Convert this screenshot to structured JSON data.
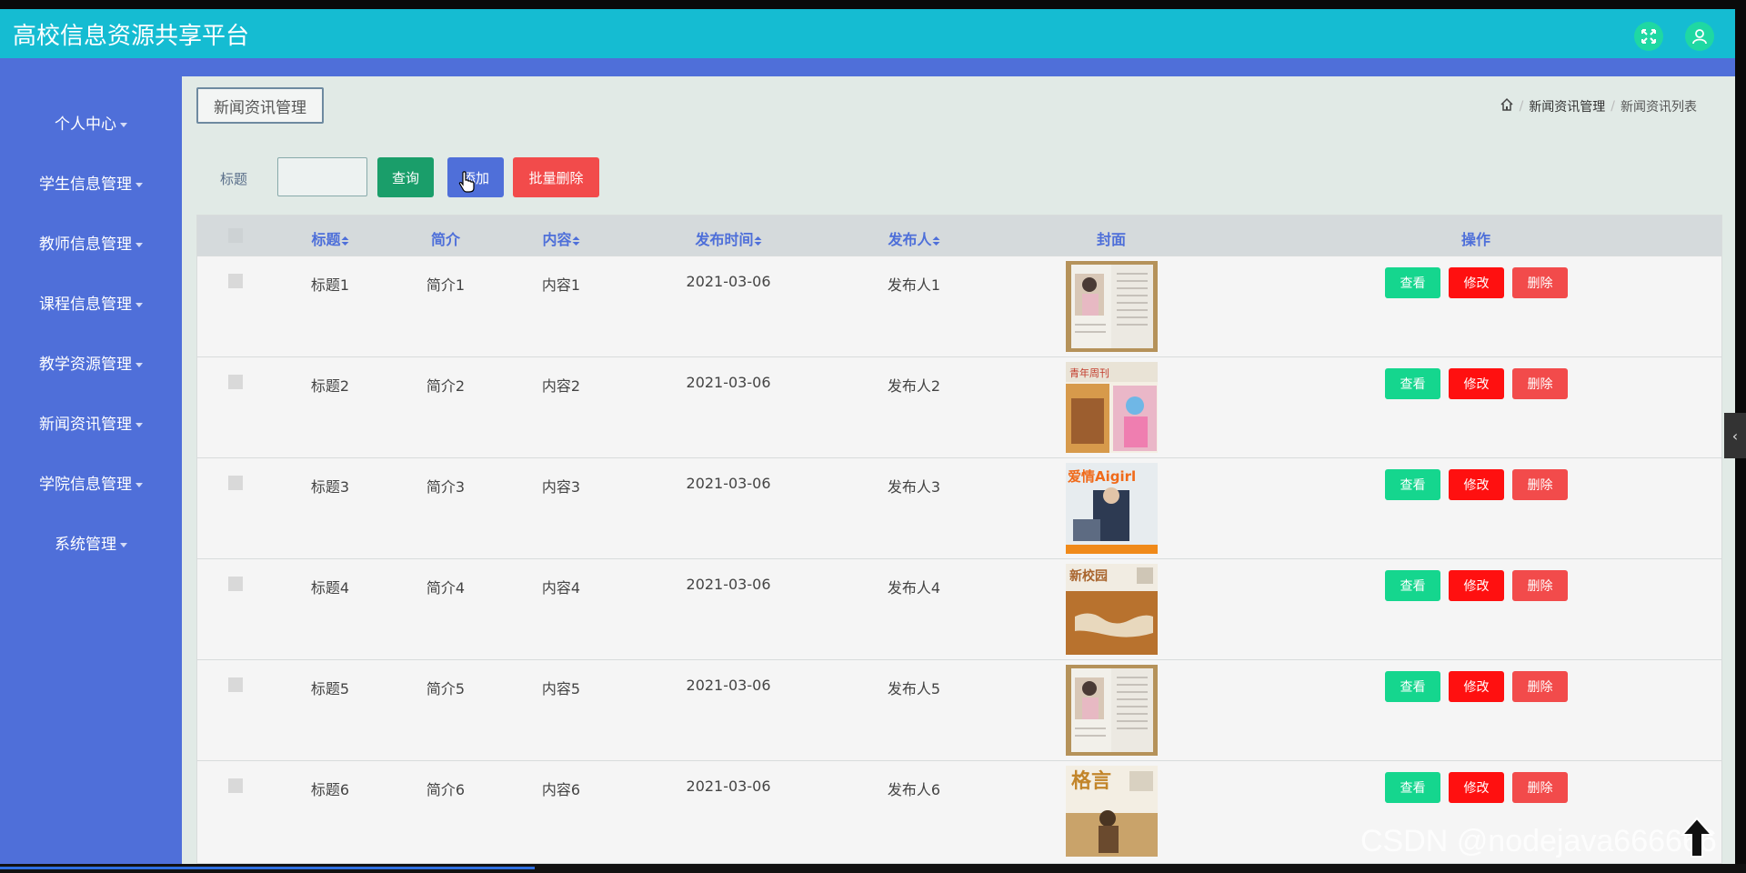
{
  "app": {
    "title": "高校信息资源共享平台"
  },
  "header_icons": [
    "fullscreen-icon",
    "user-icon"
  ],
  "sidebar": {
    "items": [
      {
        "label": "个人中心"
      },
      {
        "label": "学生信息管理"
      },
      {
        "label": "教师信息管理"
      },
      {
        "label": "课程信息管理"
      },
      {
        "label": "教学资源管理"
      },
      {
        "label": "新闻资讯管理"
      },
      {
        "label": "学院信息管理"
      },
      {
        "label": "系统管理"
      }
    ]
  },
  "page": {
    "tag": "新闻资讯管理",
    "breadcrumb": [
      "新闻资讯管理",
      "新闻资讯列表"
    ]
  },
  "search": {
    "label": "标题",
    "value": "",
    "query_btn": "查询",
    "add_btn": "添加",
    "batch_delete_btn": "批量删除"
  },
  "table": {
    "columns": [
      "标题",
      "简介",
      "内容",
      "发布时间",
      "发布人",
      "封面",
      "操作"
    ],
    "rows": [
      {
        "title": "标题1",
        "intro": "简介1",
        "content": "内容1",
        "time": "2021-03-06",
        "publisher": "发布人1"
      },
      {
        "title": "标题2",
        "intro": "简介2",
        "content": "内容2",
        "time": "2021-03-06",
        "publisher": "发布人2"
      },
      {
        "title": "标题3",
        "intro": "简介3",
        "content": "内容3",
        "time": "2021-03-06",
        "publisher": "发布人3"
      },
      {
        "title": "标题4",
        "intro": "简介4",
        "content": "内容4",
        "time": "2021-03-06",
        "publisher": "发布人4"
      },
      {
        "title": "标题5",
        "intro": "简介5",
        "content": "内容5",
        "time": "2021-03-06",
        "publisher": "发布人5"
      },
      {
        "title": "标题6",
        "intro": "简介6",
        "content": "内容6",
        "time": "2021-03-06",
        "publisher": "发布人6"
      }
    ],
    "actions": {
      "view": "查看",
      "edit": "修改",
      "delete": "删除"
    }
  },
  "cover_text": {
    "cover2": "青年周刊",
    "cover3": "爱情Aigirl",
    "cover4": "新校园",
    "cover6": "格言"
  },
  "watermark": "CSDN @nodejava666666",
  "colors": {
    "header": "#15bcd2",
    "sidebar": "#4f6fd9",
    "query": "#1a9e6a",
    "add": "#4f6fd9",
    "batch_delete": "#f24b4b",
    "view": "#15d68e",
    "edit": "#ff1010",
    "delete": "#f24b4b"
  }
}
